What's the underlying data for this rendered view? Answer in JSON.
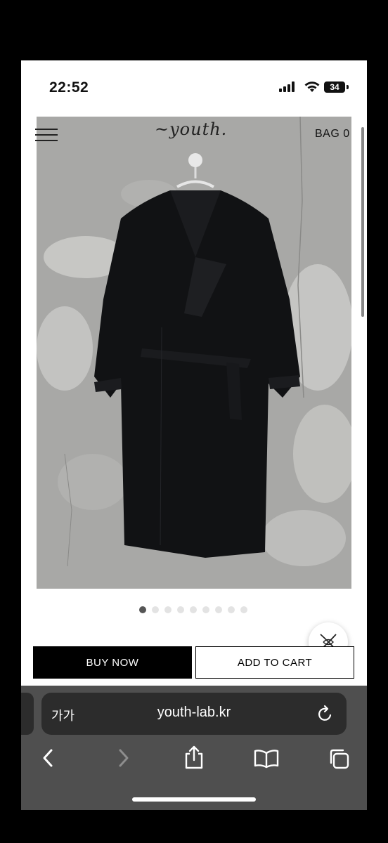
{
  "status_bar": {
    "time": "22:52",
    "battery": "34",
    "icons": [
      "signal-icon",
      "wifi-icon",
      "battery-icon"
    ]
  },
  "site": {
    "logo": "~youth.",
    "bag_label": "BAG 0",
    "menu_icon": "hamburger-menu-icon"
  },
  "gallery": {
    "slide_count": 9,
    "active_index": 0
  },
  "actions": {
    "buy_now": "BUY NOW",
    "add_to_cart": "ADD TO CART"
  },
  "browser": {
    "text_size_label": "가가",
    "url": "youth-lab.kr",
    "icons": [
      "reload-icon",
      "back-icon",
      "forward-icon",
      "share-icon",
      "bookmarks-icon",
      "tabs-icon"
    ]
  },
  "colors": {
    "accent": "#000000",
    "toolbar": "#4f4f4f",
    "urlbar": "#2c2c2c"
  }
}
